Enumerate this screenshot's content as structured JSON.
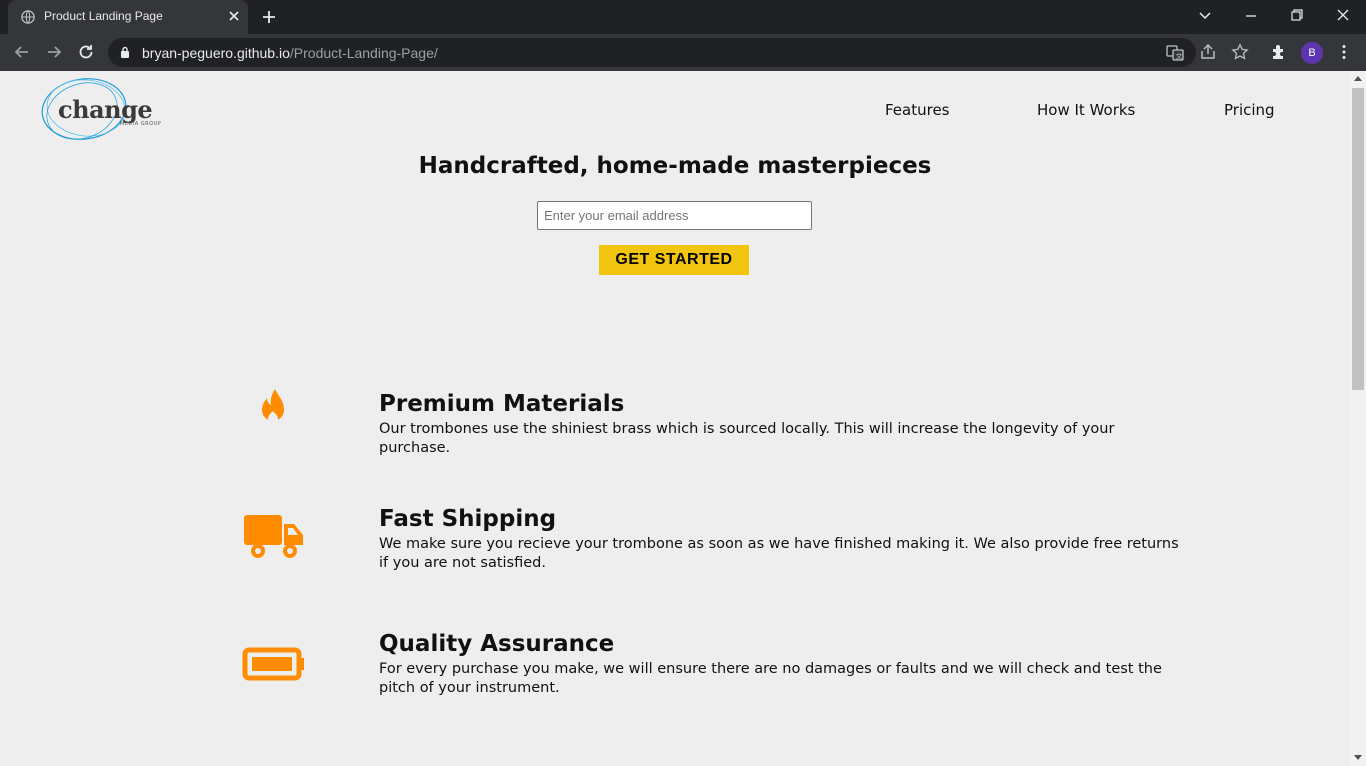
{
  "browser": {
    "tab_title": "Product Landing Page",
    "url_host": "bryan-peguero.github.io",
    "url_path": "/Product-Landing-Page/",
    "profile_initial": "B"
  },
  "header": {
    "logo_word": "change",
    "logo_sub": "MEDIA GROUP",
    "nav": [
      "Features",
      "How It Works",
      "Pricing"
    ]
  },
  "hero": {
    "title": "Handcrafted, home-made masterpieces",
    "email_placeholder": "Enter your email address",
    "cta_label": "GET STARTED"
  },
  "features": [
    {
      "icon": "fire-icon",
      "title": "Premium Materials",
      "desc": "Our trombones use the shiniest brass which is sourced locally. This will increase the longevity of your purchase."
    },
    {
      "icon": "truck-icon",
      "title": "Fast Shipping",
      "desc": "We make sure you recieve your trombone as soon as we have finished making it. We also provide free returns if you are not satisfied."
    },
    {
      "icon": "battery-icon",
      "title": "Quality Assurance",
      "desc": "For every purchase you make, we will ensure there are no damages or faults and we will check and test the pitch of your instrument."
    }
  ],
  "colors": {
    "accent_orange": "#ff8c00",
    "cta_yellow": "#f1c40f",
    "logo_blue": "#1e9bd7"
  }
}
